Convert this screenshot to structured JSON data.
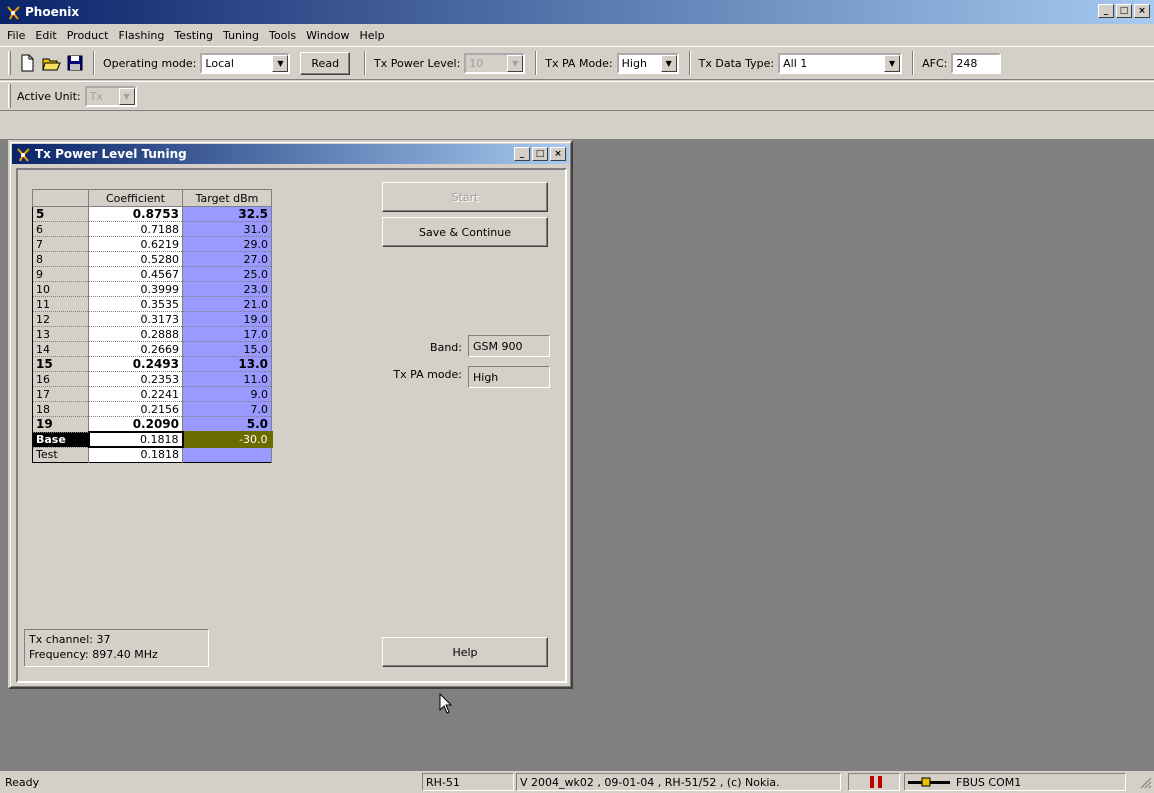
{
  "app": {
    "title": "Phoenix",
    "window_buttons": [
      "_",
      "□",
      "×"
    ]
  },
  "menu": [
    "File",
    "Edit",
    "Product",
    "Flashing",
    "Testing",
    "Tuning",
    "Tools",
    "Window",
    "Help"
  ],
  "toolbar": {
    "operating_mode_label": "Operating mode:",
    "operating_mode_value": "Local",
    "read_label": "Read",
    "tx_power_level_label": "Tx Power Level:",
    "tx_power_level_value": "10",
    "tx_pa_mode_label": "Tx PA Mode:",
    "tx_pa_mode_value": "High",
    "tx_data_type_label": "Tx Data Type:",
    "tx_data_type_value": "All 1",
    "afc_label": "AFC:",
    "afc_value": "248",
    "active_unit_label": "Active Unit:",
    "active_unit_value": "Tx"
  },
  "dialog": {
    "title": "Tx Power Level Tuning",
    "table": {
      "headers": [
        "",
        "Coefficient",
        "Target dBm"
      ],
      "rows": [
        {
          "level": "5",
          "coefficient": "0.8753",
          "target": "32.5",
          "bold": true
        },
        {
          "level": "6",
          "coefficient": "0.7188",
          "target": "31.0"
        },
        {
          "level": "7",
          "coefficient": "0.6219",
          "target": "29.0"
        },
        {
          "level": "8",
          "coefficient": "0.5280",
          "target": "27.0"
        },
        {
          "level": "9",
          "coefficient": "0.4567",
          "target": "25.0"
        },
        {
          "level": "10",
          "coefficient": "0.3999",
          "target": "23.0"
        },
        {
          "level": "11",
          "coefficient": "0.3535",
          "target": "21.0"
        },
        {
          "level": "12",
          "coefficient": "0.3173",
          "target": "19.0"
        },
        {
          "level": "13",
          "coefficient": "0.2888",
          "target": "17.0"
        },
        {
          "level": "14",
          "coefficient": "0.2669",
          "target": "15.0"
        },
        {
          "level": "15",
          "coefficient": "0.2493",
          "target": "13.0",
          "bold": true
        },
        {
          "level": "16",
          "coefficient": "0.2353",
          "target": "11.0"
        },
        {
          "level": "17",
          "coefficient": "0.2241",
          "target": "9.0"
        },
        {
          "level": "18",
          "coefficient": "0.2156",
          "target": "7.0"
        },
        {
          "level": "19",
          "coefficient": "0.2090",
          "target": "5.0",
          "bold": true
        },
        {
          "level": "Base",
          "coefficient": "0.1818",
          "target": "-30.0",
          "base": true
        },
        {
          "level": "Test",
          "coefficient": "0.1818",
          "target": ""
        }
      ]
    },
    "start_label": "Start",
    "save_continue_label": "Save & Continue",
    "band_label": "Band:",
    "band_value": "GSM 900",
    "tx_pa_mode_label": "Tx PA mode:",
    "tx_pa_mode_value": "High",
    "tx_channel": "Tx channel: 37",
    "frequency": "Frequency:  897.40 MHz",
    "help_label": "Help"
  },
  "status": {
    "ready": "Ready",
    "product": "RH-51",
    "version": "V 2004_wk02 , 09-01-04 , RH-51/52 , (c) Nokia.",
    "connection": "FBUS COM1"
  },
  "colors": {
    "title_gradient_start": "#0a246a",
    "title_gradient_end": "#a6caf0",
    "target_column": "#9999ff",
    "base_target": "#6b6b00",
    "workspace": "#808080"
  }
}
